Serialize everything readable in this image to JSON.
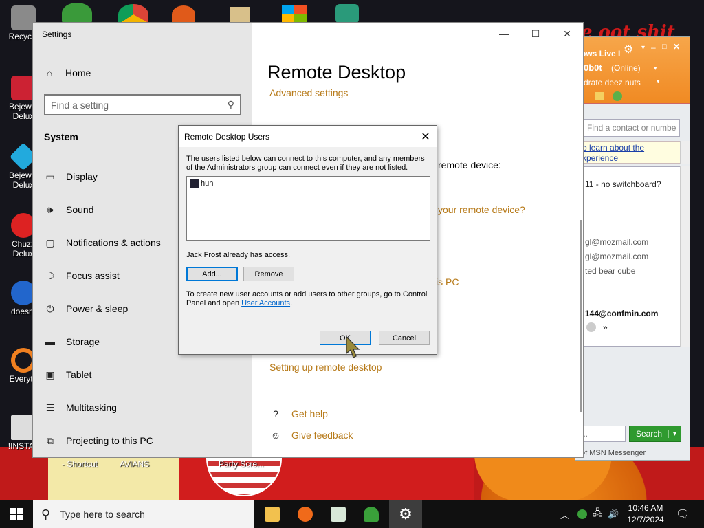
{
  "desktop": {
    "wallpaper_text": "e oot shit",
    "icons": [
      {
        "label": "Recycle",
        "color": "#8a8a8a"
      },
      {
        "label": "Bejewel\nDelux",
        "color": "#cc2233"
      },
      {
        "label": "Bejewel\nDelux",
        "color": "#22aadd"
      },
      {
        "label": "Chuzz\nDelux",
        "color": "#dd2222"
      },
      {
        "label": "doesnt",
        "color": "#2266cc"
      },
      {
        "label": "Everyth",
        "color": "#f08020"
      },
      {
        "label": "!INSTAL",
        "color": "#dddddd"
      }
    ],
    "bottom_labels": [
      "- Shortcut",
      "AVIANS",
      "Party Scre..."
    ]
  },
  "settings": {
    "app_title": "Settings",
    "home_label": "Home",
    "search_placeholder": "Find a setting",
    "section_label": "System",
    "nav": [
      {
        "label": "Display",
        "icon": "display-icon"
      },
      {
        "label": "Sound",
        "icon": "sound-icon"
      },
      {
        "label": "Notifications & actions",
        "icon": "notifications-icon"
      },
      {
        "label": "Focus assist",
        "icon": "focus-assist-icon"
      },
      {
        "label": "Power & sleep",
        "icon": "power-icon"
      },
      {
        "label": "Storage",
        "icon": "storage-icon"
      },
      {
        "label": "Tablet",
        "icon": "tablet-icon"
      },
      {
        "label": "Multitasking",
        "icon": "multitasking-icon"
      },
      {
        "label": "Projecting to this PC",
        "icon": "projecting-icon"
      }
    ],
    "page_title": "Remote Desktop",
    "advanced_link": "Advanced settings",
    "fragment_remote_device": "remote device:",
    "fragment_link_device": "your remote device?",
    "fragment_link_pc": "is PC",
    "setup_link": "Setting up remote desktop",
    "get_help": "Get help",
    "give_feedback": "Give feedback"
  },
  "msn": {
    "title": "ows Live I",
    "user": "0b0t",
    "status": "(Online)",
    "personal_msg": "ydrate deez nuts",
    "find_placeholder": "Find a contact or numbe",
    "info_line1": "o learn about the",
    "info_line2": "xperience",
    "contacts": [
      "11 - no switchboard?",
      "gl@mozmail.com",
      "gl@mozmail.com",
      "ted bear cube",
      "144@confmin.com",
      "»"
    ],
    "search_button": "Search",
    "footer": "of MSN Messenger"
  },
  "dialog": {
    "title": "Remote Desktop Users",
    "description": "The users listed below can connect to this computer, and any members of the Administrators group can connect even if they are not listed.",
    "users": [
      "huh"
    ],
    "access_note": "Jack Frost already has access.",
    "add_button": "Add...",
    "remove_button": "Remove",
    "note_prefix": "To create new user accounts or add users to other groups, go to Control Panel and open ",
    "note_link": "User Accounts",
    "note_suffix": ".",
    "ok_button": "OK",
    "cancel_button": "Cancel"
  },
  "taskbar": {
    "search_placeholder": "Type here to search",
    "time": "10:46 AM",
    "date": "12/7/2024"
  },
  "colors": {
    "accent_link": "#b77a19",
    "msn_header": "#f08a23",
    "dialog_default_border": "#0078d7"
  }
}
